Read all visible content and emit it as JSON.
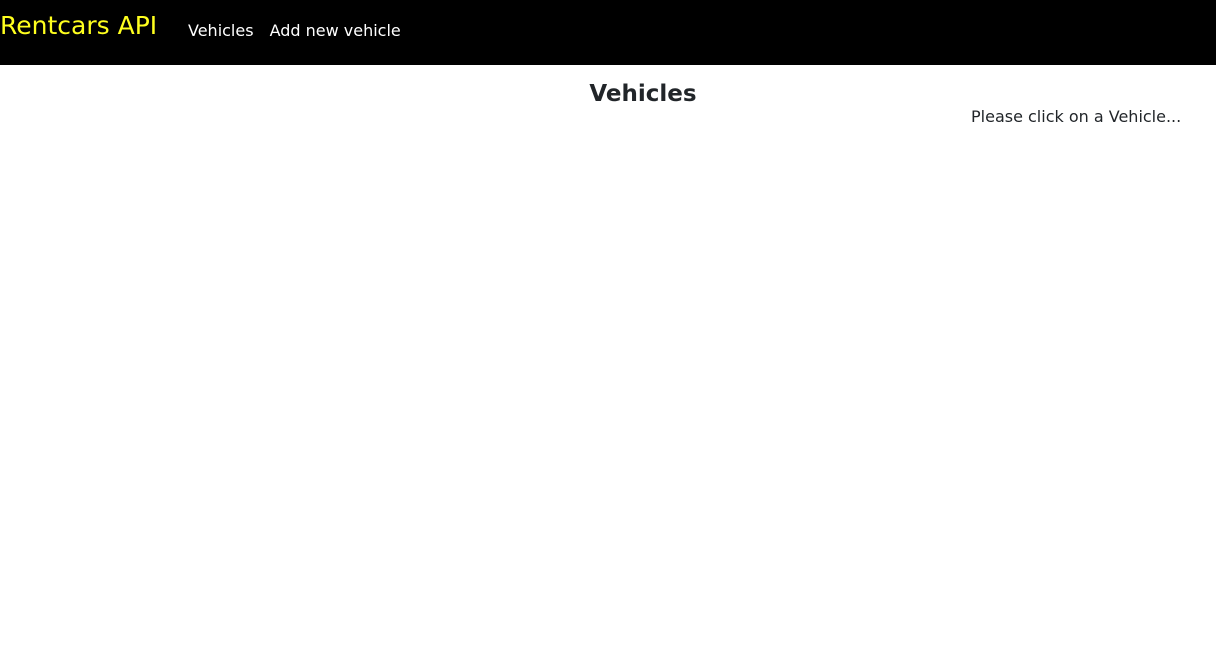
{
  "navbar": {
    "brand": "Rentcars API",
    "links": [
      {
        "label": "Vehicles"
      },
      {
        "label": "Add new vehicle"
      }
    ]
  },
  "main": {
    "title": "Vehicles",
    "vehicles": [],
    "detail_prompt": "Please click on a Vehicle..."
  },
  "colors": {
    "navbar_bg": "#000000",
    "brand": "#ffff1e",
    "nav_link": "#ffffff",
    "text": "#212529"
  }
}
